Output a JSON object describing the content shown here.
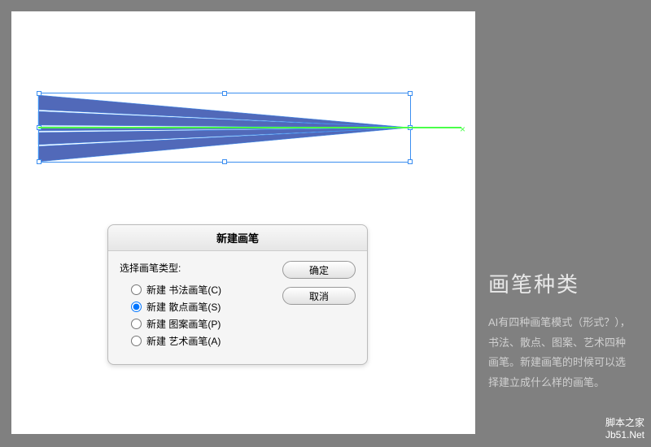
{
  "dialog": {
    "title": "新建画笔",
    "section_label": "选择画笔类型:",
    "options": [
      {
        "label": "新建 书法画笔(C)",
        "selected": false
      },
      {
        "label": "新建 散点画笔(S)",
        "selected": true
      },
      {
        "label": "新建 图案画笔(P)",
        "selected": false
      },
      {
        "label": "新建 艺术画笔(A)",
        "selected": false
      }
    ],
    "ok_label": "确定",
    "cancel_label": "取消"
  },
  "sidebar": {
    "title": "画笔种类",
    "body": "AI有四种画笔模式（形式？），书法、散点、图案、艺术四种画笔。新建画笔的时候可以选择建立成什么样的画笔。"
  },
  "watermark": {
    "line1": "脚本之家",
    "line2": "Jb51.Net"
  },
  "icons": {
    "radio": "radio-icon"
  }
}
